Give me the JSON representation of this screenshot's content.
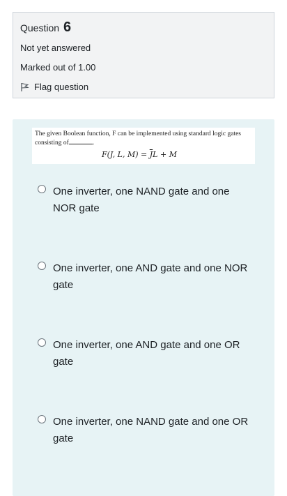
{
  "info": {
    "question_label": "Question",
    "question_number": "6",
    "state": "Not yet answered",
    "grade": "Marked out of 1.00",
    "flag_label": "Flag question"
  },
  "question": {
    "text_line1": "The given Boolean function, F can be implemented using standard logic gates",
    "text_line2": "consisting of",
    "formula_lhs": "F(J, L, M) = ",
    "formula_bar": "J̅L",
    "formula_rhs": " + M"
  },
  "options": [
    {
      "label": "One inverter, one NAND gate and one NOR gate"
    },
    {
      "label": "One inverter, one AND gate and one NOR gate"
    },
    {
      "label": "One inverter, one AND gate and one OR gate"
    },
    {
      "label": "One inverter, one NAND gate and one OR gate"
    }
  ]
}
